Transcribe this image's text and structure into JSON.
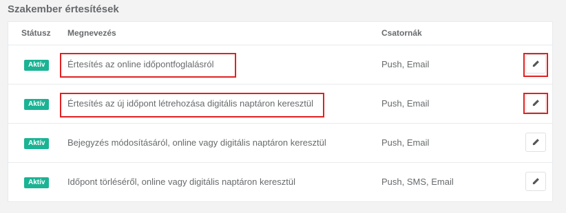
{
  "section_title": "Szakember értesítések",
  "table": {
    "headers": {
      "status": "Státusz",
      "name": "Megnevezés",
      "channels": "Csatornák"
    },
    "rows": [
      {
        "status": "Aktív",
        "name": "Értesítés az online időpontfoglalásról",
        "channels": "Push, Email",
        "highlighted": true
      },
      {
        "status": "Aktív",
        "name": "Értesítés az új időpont létrehozása digitális naptáron keresztül",
        "channels": "Push, Email",
        "highlighted": true
      },
      {
        "status": "Aktív",
        "name": "Bejegyzés módosításáról, online vagy digitális naptáron keresztül",
        "channels": "Push, Email",
        "highlighted": false
      },
      {
        "status": "Aktív",
        "name": "Időpont törléséről, online vagy digitális naptáron keresztül",
        "channels": "Push, SMS, Email",
        "highlighted": false
      }
    ]
  },
  "icons": {
    "edit": "pencil-icon"
  },
  "colors": {
    "badge": "#1ab394",
    "highlight": "#e02020"
  }
}
